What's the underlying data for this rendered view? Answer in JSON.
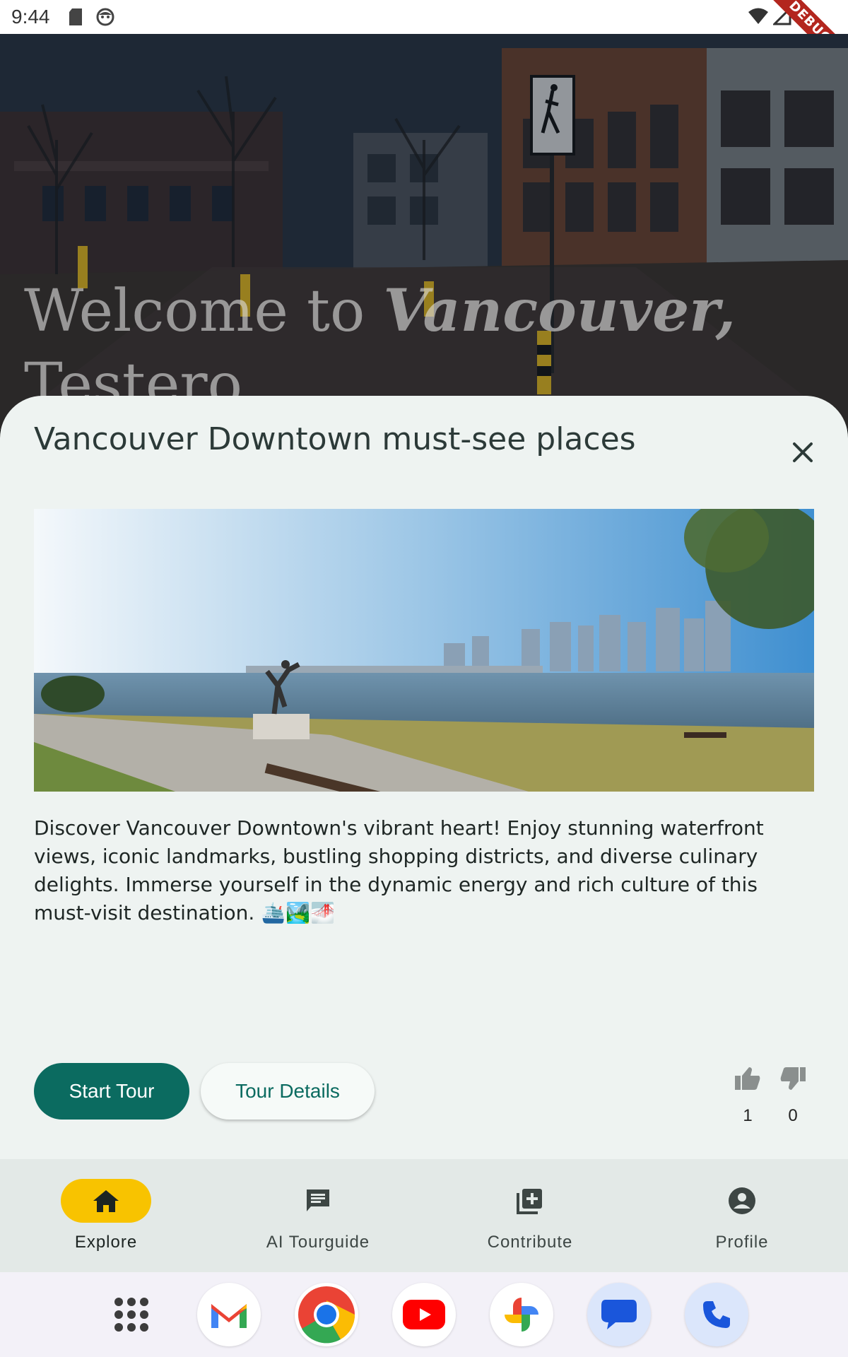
{
  "status_bar": {
    "time": "9:44",
    "debug_label": "DEBUG"
  },
  "hero": {
    "welcome_prefix": "Welcome to ",
    "city": "Vancouver",
    "comma": ",",
    "user_name": "Testero"
  },
  "sheet": {
    "title": "Vancouver Downtown must-see places",
    "description": "Discover Vancouver Downtown's vibrant heart! Enjoy stunning waterfront views, iconic landmarks, bustling shopping districts, and diverse culinary delights. Immerse yourself in the dynamic energy and rich culture of this must-visit destination. 🛳️🏞️🌁",
    "start_tour_label": "Start Tour",
    "tour_details_label": "Tour Details",
    "likes": "1",
    "dislikes": "0"
  },
  "bottom_nav": {
    "items": [
      {
        "label": "Explore",
        "icon": "home-icon",
        "active": true
      },
      {
        "label": "AI Tourguide",
        "icon": "chat-icon",
        "active": false
      },
      {
        "label": "Contribute",
        "icon": "add-box-icon",
        "active": false
      },
      {
        "label": "Profile",
        "icon": "account-circle-icon",
        "active": false
      }
    ]
  },
  "dock": {
    "apps": [
      "app-drawer",
      "gmail",
      "chrome",
      "youtube",
      "photos",
      "messages",
      "phone"
    ]
  },
  "colors": {
    "primary": "#0b6b60",
    "accent": "#f8c300",
    "sheet_bg": "#eef3f1",
    "nav_bg": "#e3e9e7"
  }
}
